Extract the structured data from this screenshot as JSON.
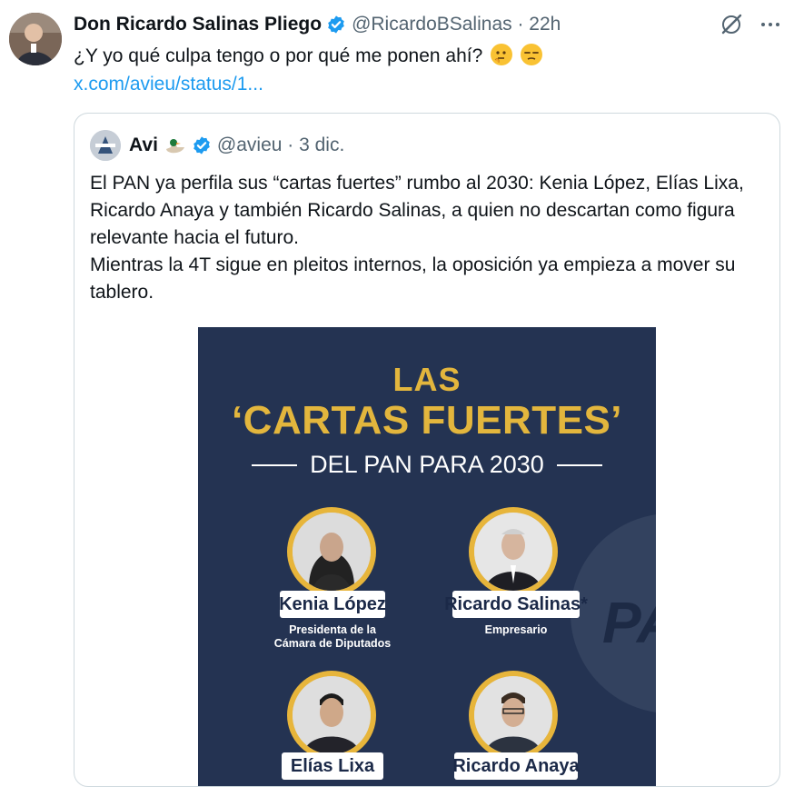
{
  "tweet": {
    "author_name": "Don Ricardo Salinas Pliego",
    "handle": "@RicardoBSalinas",
    "time": "22h",
    "text": "¿Y yo qué culpa tengo o por qué me ponen ahí?",
    "emojis": [
      "thinking-face-emoji",
      "unamused-face-emoji"
    ],
    "link": "x.com/avieu/status/1..."
  },
  "quote": {
    "author_name": "Avi",
    "handle": "@avieu",
    "date": "3 dic.",
    "paragraphs": [
      "El PAN ya perfila sus “cartas fuertes” rumbo al 2030: Kenia López, Elías Lixa, Ricardo Anaya y también Ricardo Salinas, a quien no descartan como figura relevante hacia el futuro.",
      "Mientras la 4T sigue en pleitos internos, la oposición ya empieza a mover su tablero."
    ]
  },
  "poster": {
    "title_line1": "LAS",
    "title_line2": "‘CARTAS FUERTES’",
    "title_line3": "DEL PAN PARA 2030",
    "watermark": "PAN",
    "people": [
      {
        "name": "Kenia López",
        "role_line1": "Presidenta de la",
        "role_line2": "Cámara de Diputados"
      },
      {
        "name": "Ricardo Salinas*",
        "role_line1": "Empresario",
        "role_line2": ""
      },
      {
        "name": "Elías Lixa",
        "role_line1": "",
        "role_line2": ""
      },
      {
        "name": "Ricardo Anaya",
        "role_line1": "",
        "role_line2": ""
      }
    ]
  },
  "colors": {
    "verified": "#1d9bf0",
    "link": "#1d9bf0",
    "poster_bg": "#243352",
    "poster_gold": "#e3b63d"
  }
}
